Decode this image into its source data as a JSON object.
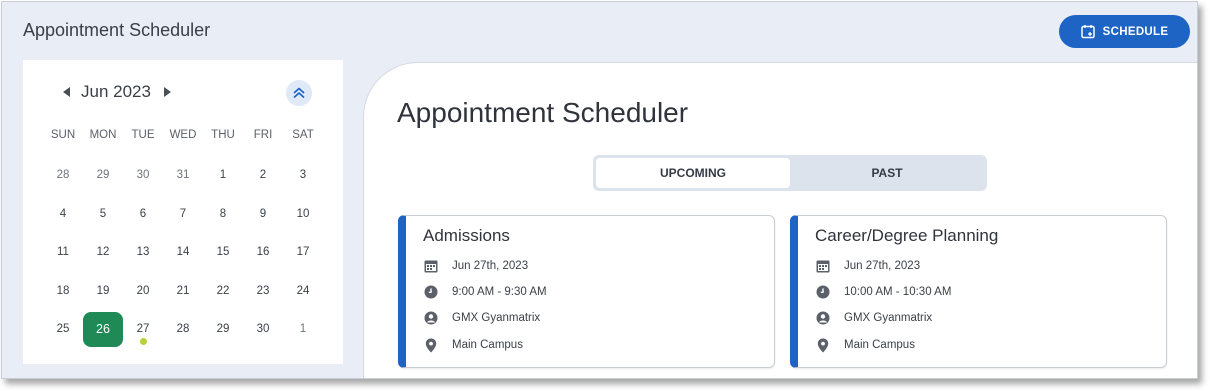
{
  "header": {
    "app_title": "Appointment Scheduler",
    "schedule_button": "SCHEDULE"
  },
  "calendar": {
    "month_label": "Jun 2023",
    "weekdays": [
      "SUN",
      "MON",
      "TUE",
      "WED",
      "THU",
      "FRI",
      "SAT"
    ],
    "weeks": [
      [
        "28",
        "29",
        "30",
        "31",
        "1",
        "2",
        "3"
      ],
      [
        "4",
        "5",
        "6",
        "7",
        "8",
        "9",
        "10"
      ],
      [
        "11",
        "12",
        "13",
        "14",
        "15",
        "16",
        "17"
      ],
      [
        "18",
        "19",
        "20",
        "21",
        "22",
        "23",
        "24"
      ],
      [
        "25",
        "26",
        "27",
        "28",
        "29",
        "30",
        "1"
      ]
    ],
    "selected_day": "26",
    "event_day": "27",
    "selected_color": "#1f8a55",
    "event_dot_color": "#b5d334"
  },
  "main": {
    "title": "Appointment Scheduler",
    "tabs": [
      {
        "label": "UPCOMING",
        "active": true
      },
      {
        "label": "PAST",
        "active": false
      }
    ],
    "accent_color": "#1d64c4",
    "cards": [
      {
        "title": "Admissions",
        "date": "Jun 27th, 2023",
        "time": "9:00 AM - 9:30 AM",
        "host": "GMX Gyanmatrix",
        "location": "Main Campus"
      },
      {
        "title": "Career/Degree Planning",
        "date": "Jun 27th, 2023",
        "time": "10:00 AM - 10:30 AM",
        "host": "GMX Gyanmatrix",
        "location": "Main Campus"
      }
    ]
  },
  "icons": {
    "schedule_button": "calendar-add-icon",
    "prev_month": "caret-left-icon",
    "next_month": "caret-right-icon",
    "collapse": "double-chevron-up-icon",
    "date": "calendar-icon",
    "time": "clock-icon",
    "host": "user-circle-icon",
    "location": "map-pin-icon"
  }
}
